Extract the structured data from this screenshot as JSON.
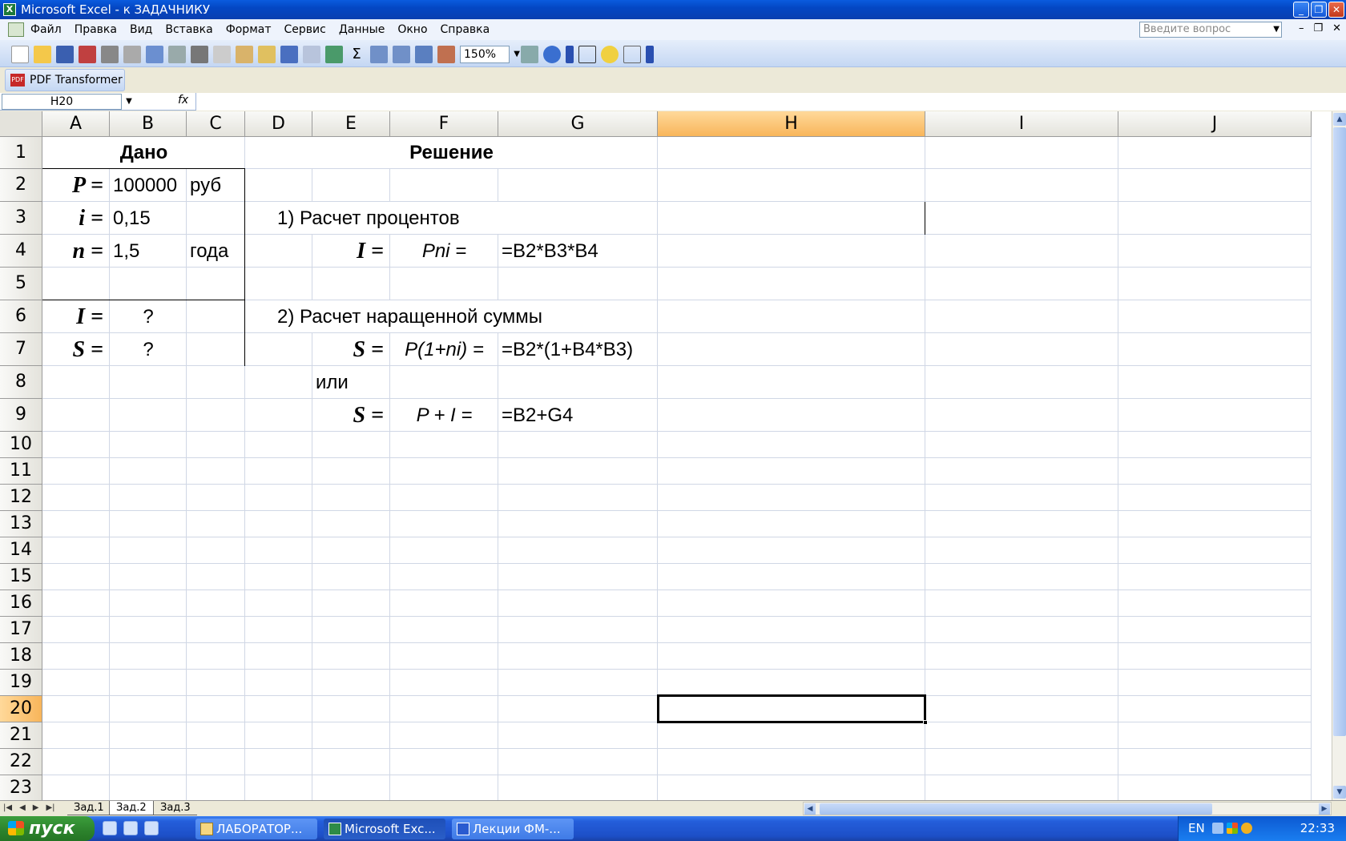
{
  "window": {
    "title": "Microsoft Excel - к ЗАДАЧНИКУ"
  },
  "menu": {
    "items": [
      "Файл",
      "Правка",
      "Вид",
      "Вставка",
      "Формат",
      "Сервис",
      "Данные",
      "Окно",
      "Справка"
    ],
    "ask_placeholder": "Введите вопрос"
  },
  "toolbar": {
    "zoom": "150%",
    "pdf_transformer": "PDF Transformer"
  },
  "formula_bar": {
    "name_box": "H20",
    "fx": "fx",
    "formula": ""
  },
  "columns": [
    "A",
    "B",
    "C",
    "D",
    "E",
    "F",
    "G",
    "H",
    "I",
    "J"
  ],
  "active_column": "H",
  "rows": [
    "1",
    "2",
    "3",
    "4",
    "5",
    "6",
    "7",
    "8",
    "9",
    "10",
    "11",
    "12",
    "13",
    "14",
    "15",
    "16",
    "17",
    "18",
    "19",
    "20",
    "21",
    "22",
    "23"
  ],
  "active_row": "20",
  "cells": {
    "dano": "Дано",
    "reshenie": "Решение",
    "a2": "P =",
    "b2": "100000",
    "c2": "руб",
    "a3": "i =",
    "b3": "0,15",
    "a4": "n =",
    "b4": "1,5",
    "c4": "года",
    "a6": "I =",
    "b6": "?",
    "a7": "S =",
    "b7": "?",
    "d3": "1) Расчет процентов",
    "e4": "I =",
    "f4": "Pni =",
    "g4": "=B2*B3*B4",
    "d6": "2) Расчет наращенной суммы",
    "e7": "S =",
    "f7": "P(1+ni) =",
    "g7": "=B2*(1+B4*B3)",
    "e8": "или",
    "e9": "S =",
    "f9": "P + I =",
    "g9": "=B2+G4"
  },
  "sheets": {
    "tabs": [
      "Зад.1",
      "Зад.2",
      "Зад.3"
    ],
    "active": "Зад.2"
  },
  "taskbar": {
    "start": "пуск",
    "items": [
      "ЛАБОРАТОР...",
      "Microsoft Exc...",
      "Лекции ФМ-..."
    ],
    "lang": "EN",
    "clock": "22:33"
  }
}
